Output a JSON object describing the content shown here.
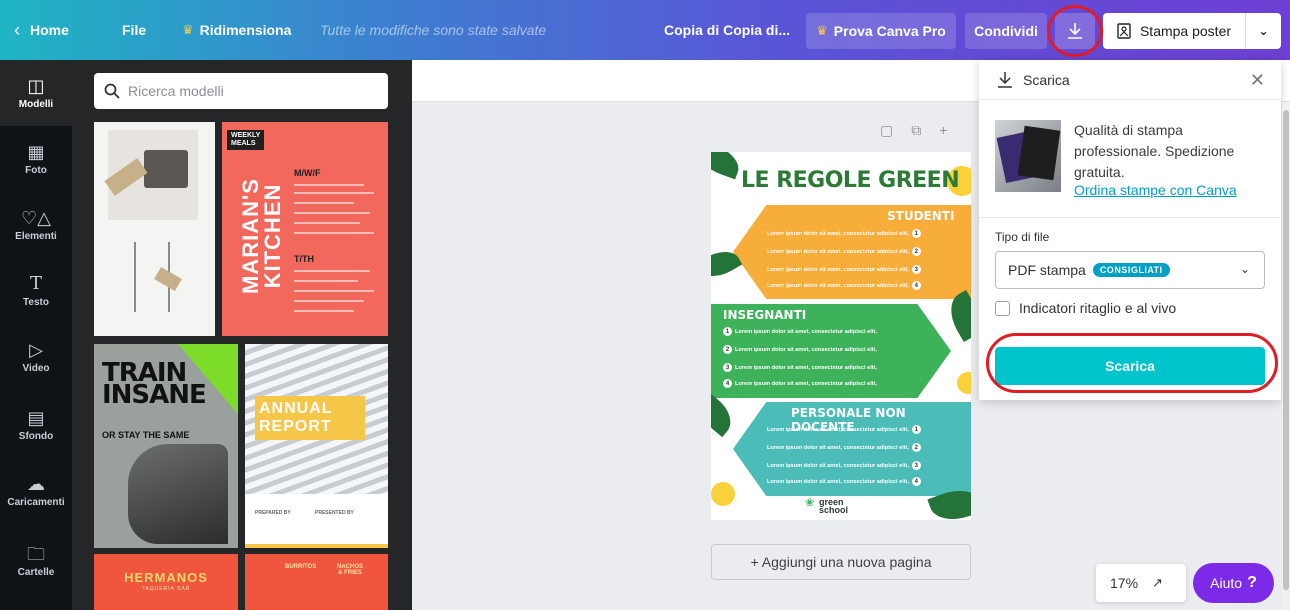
{
  "topbar": {
    "home": "Home",
    "file": "File",
    "resize": "Ridimensiona",
    "saved_status": "Tutte le modifiche sono state salvate",
    "doc_title": "Copia di Copia di...",
    "pro": "Prova Canva Pro",
    "share": "Condividi",
    "print": "Stampa poster"
  },
  "sidebar": {
    "items": [
      {
        "label": "Modelli",
        "icon": "templates-icon"
      },
      {
        "label": "Foto",
        "icon": "photo-icon"
      },
      {
        "label": "Elementi",
        "icon": "elements-icon"
      },
      {
        "label": "Testo",
        "icon": "text-icon"
      },
      {
        "label": "Video",
        "icon": "video-icon"
      },
      {
        "label": "Sfondo",
        "icon": "background-icon"
      },
      {
        "label": "Caricamenti",
        "icon": "upload-icon"
      },
      {
        "label": "Cartelle",
        "icon": "folder-icon"
      }
    ]
  },
  "search": {
    "placeholder": "Ricerca modelli"
  },
  "templates": {
    "meals": {
      "header": "WEEKLY\nMEALS",
      "vertical": "MARIAN'S KITCHEN",
      "day1": "M/W/F",
      "day2": "T/TH"
    },
    "train": {
      "title": "TRAIN\nINSANE",
      "subtitle": "OR STAY THE SAME"
    },
    "report": {
      "title": "ANNUAL\nREPORT",
      "prepared": "PREPARED BY",
      "presented": "PRESENTED BY"
    },
    "hermanos": {
      "title": "HERMANOS",
      "subtitle": "TAQUERIA BAR"
    },
    "menu": {
      "col1": "BURRITOS",
      "col2": "NACHOS\n& FRIES"
    }
  },
  "poster": {
    "title": "LE REGOLE GREEN",
    "section1": "STUDENTI",
    "section2": "INSEGNANTI",
    "section3": "PERSONALE NON DOCENTE",
    "line": "Lorem ipsum dolor sit amet, consectetur adipisci elit,",
    "n1": "1",
    "n2": "2",
    "n3": "3",
    "n4": "4",
    "logo": "green\nschool"
  },
  "canvas": {
    "add_page": "+ Aggiungi una nuova pagina"
  },
  "download_panel": {
    "title": "Scarica",
    "promo_text": "Qualità di stampa professionale. Spedizione gratuita.",
    "promo_link": "Ordina stampe con Canva",
    "file_type_label": "Tipo di file",
    "file_type_value": "PDF stampa",
    "recommended_badge": "CONSIGLIATI",
    "crop_marks": "Indicatori ritaglio e al vivo",
    "download_button": "Scarica"
  },
  "footer": {
    "zoom": "17%",
    "help": "Aiuto"
  },
  "colors": {
    "accent": "#00c4cc",
    "brand_purple": "#7d2ae8",
    "annotation_red": "#e01c24"
  }
}
